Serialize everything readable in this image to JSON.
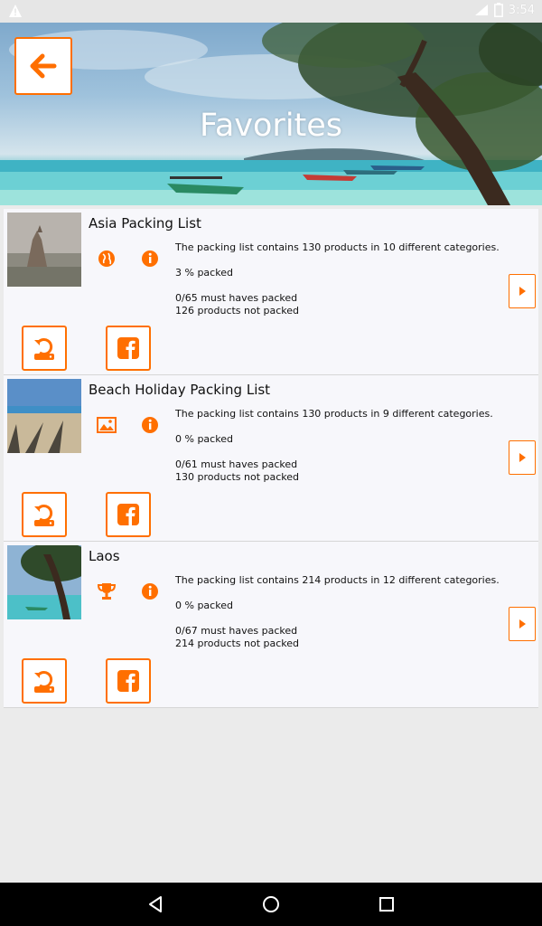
{
  "status_bar": {
    "time": "3:54",
    "network": "3G"
  },
  "header": {
    "title": "Favorites"
  },
  "colors": {
    "accent": "#ff6f00",
    "card_bg": "#f7f7fb",
    "page_bg": "#ebebeb"
  },
  "lists": [
    {
      "title": "Asia Packing List",
      "icon": "globe-icon",
      "description": "The packing list contains 130 products in 10 different categories.",
      "packed": "3 % packed",
      "must_haves": "0/65 must haves packed",
      "not_packed": "126 products not packed"
    },
    {
      "title": "Beach Holiday Packing List",
      "icon": "image-icon",
      "description": "The packing list contains 130 products in 9 different categories.",
      "packed": "0 % packed",
      "must_haves": "0/61 must haves packed",
      "not_packed": "130 products not packed"
    },
    {
      "title": "Laos",
      "icon": "trophy-icon",
      "description": "The packing list contains 214 products in 12 different categories.",
      "packed": "0 % packed",
      "must_haves": "0/67 must haves packed",
      "not_packed": "214 products not packed"
    }
  ]
}
